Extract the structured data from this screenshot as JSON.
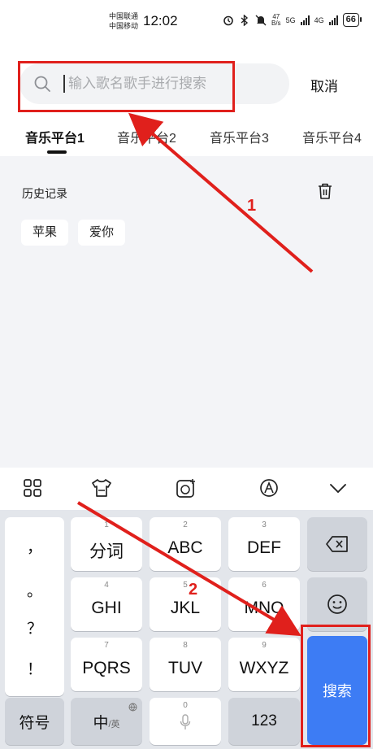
{
  "status_bar": {
    "carrier_1": "中国联通",
    "carrier_2": "中国移动",
    "time": "12:02",
    "net_speed_value": "47",
    "net_speed_unit": "B/s",
    "signal_1_label": "5G",
    "signal_2_label": "4G",
    "battery": "66"
  },
  "search": {
    "placeholder": "输入歌名歌手进行搜索",
    "value": "",
    "cancel_label": "取消"
  },
  "tabs": [
    {
      "label": "音乐平台1",
      "active": true
    },
    {
      "label": "音乐平台2",
      "active": false
    },
    {
      "label": "音乐平台3",
      "active": false
    },
    {
      "label": "音乐平台4",
      "active": false
    }
  ],
  "history": {
    "title": "历史记录",
    "items": [
      "苹果",
      "爱你"
    ]
  },
  "keyboard": {
    "punctuation": [
      "，",
      "。",
      "？",
      "！"
    ],
    "keys": [
      {
        "num": "1",
        "label": "分词"
      },
      {
        "num": "2",
        "label": "ABC"
      },
      {
        "num": "3",
        "label": "DEF"
      },
      {
        "num": "4",
        "label": "GHI"
      },
      {
        "num": "5",
        "label": "JKL"
      },
      {
        "num": "6",
        "label": "MNO"
      },
      {
        "num": "7",
        "label": "PQRS"
      },
      {
        "num": "8",
        "label": "TUV"
      },
      {
        "num": "9",
        "label": "WXYZ"
      }
    ],
    "zero_num": "0",
    "symbols_label": "符号",
    "lang_main": "中",
    "lang_sub": "/英",
    "numbers_label": "123",
    "search_label": "搜索"
  },
  "annotations": [
    "1",
    "2"
  ],
  "colors": {
    "accent": "#3d7cf4",
    "annotation": "#e0201c"
  }
}
